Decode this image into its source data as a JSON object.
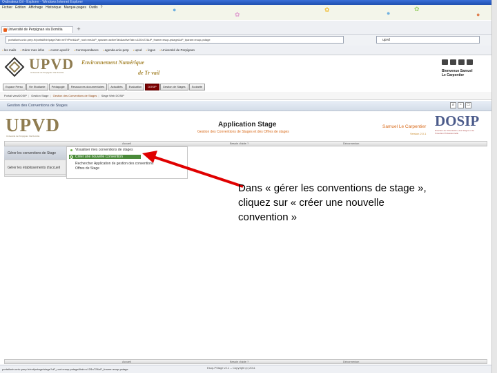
{
  "browser": {
    "title": "Ordinateur.Gil - Explorer - Windows Internet Explorer",
    "menus": [
      "Fichier",
      "Édition",
      "Affichage",
      "Historique",
      "Marque-pages",
      "Outils",
      "?"
    ],
    "tab_label": "Université de Perpignan via Domitia",
    "address": "portailuniv.univ-perp.fr/portail/bin/page?tab=nrSYPxnk&uP_root=me&uP_sparam=activeTab&activeTab=u12l1s72&uP_fname=esup-pstage&uP_tparam=esup-pstage",
    "search_value": "upvd",
    "bookmarks": [
      "les mails",
      "Gérer mes infos",
      "corem.upvd.fr",
      "Correspondance",
      "agenda.univ-perp",
      "upvd",
      "logon",
      "Université de Perpignan"
    ],
    "status_url": "portailuniv.univ-perp.fr/ent/pstage/stage?uP_root=esup-pstage&tab=u12l1s72&uP_fname=esup-pstage"
  },
  "ent": {
    "logo": "UPVD",
    "logo_sub": "Université de Perpignan Via Domitia",
    "title_line1": "Environnement Numérique",
    "title_line2": "de Tr  vail",
    "user_greeting": "Bienvenue Samuel",
    "user_name": "Le Carpentier",
    "nav_tabs": [
      "Espace Perso",
      "Vie Etudiante",
      "Pédagogie",
      "Ressources documentaires",
      "Actualités",
      "Evaluation",
      "DOSIP",
      "Gestion de Stages",
      "Scolarité"
    ],
    "active_tab_index": 6,
    "breadcrumb": [
      "Portail viewDOSIP",
      "Gestion Stage",
      "Gestion des Conventions de Stages",
      "Stage Web DOSIP"
    ]
  },
  "page": {
    "section_title": "Gestion des Conventions de Stages"
  },
  "app": {
    "logo": "UPVD",
    "logo_sub": "Université de Perpignan Via Domitia",
    "title": "Application Stage",
    "subtitle": "Gestion des Conventions de Stages et des Offres de stages",
    "user": "Samuel Le Carpentier",
    "version": "Version 2.0.1",
    "partner_logo": "DOSIP",
    "partner_sub": "Direction de l'Orientation, des Stages et de l'Insertion Professionnelle",
    "menu": [
      "Accueil",
      "Besoin d'aide ?",
      "Déconnexion"
    ],
    "left_nav": [
      "Gérer les conventions de Stage",
      "Gérer les établissements d'accueil"
    ],
    "submenu": [
      "Visualiser mes conventions de stages",
      "Créer une nouvelle Convention",
      "Rechercher Application de gestion des conventions",
      "Offres de Stage"
    ]
  },
  "callout": "Dans « gérer les conventions de stage », cliquez sur « créer une nouvelle convention »",
  "footer": "Esup-PStage v2.1 -- Copyright (c) 2011",
  "colors": {
    "accent": "#d86a1a",
    "active_tab": "#7a0000",
    "arrow": "#e00000"
  }
}
